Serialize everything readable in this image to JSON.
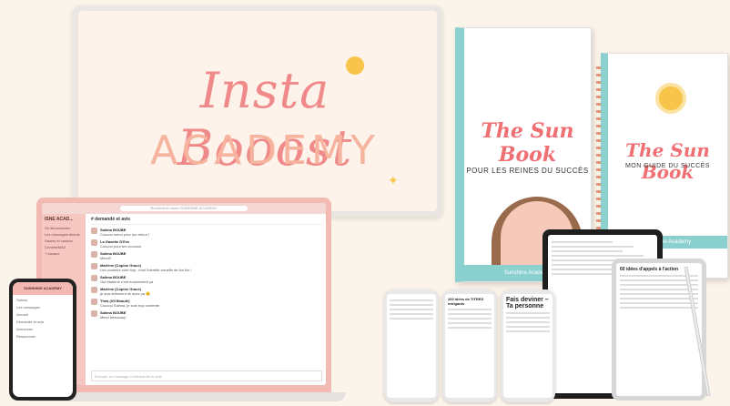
{
  "monitor": {
    "script_title": "Insta Booost",
    "block_title": "ACADEMY"
  },
  "laptop": {
    "search": "Rechercher dans SUNSHINE ACADEMY",
    "workspace": "ISNE ACAD...",
    "sidebar_items": [
      "Se déconnecter",
      "Les messages directs",
      "Salons et canaux",
      "Cercles/MAX",
      "+ canaux"
    ],
    "channel": "# demandé et avis",
    "messages": [
      {
        "name": "Salima BOUBE",
        "text": "Coucou merci pour ton retour !"
      },
      {
        "name": "La Gazette D'Eve",
        "text": "Coucou pour les coucous"
      },
      {
        "name": "Salima BOUBE",
        "text": "Merci!!"
      },
      {
        "name": "Marlène (Copine Grace)",
        "text": "Les couleurs sont trop, c'est l'identité visuelle de ton biz !"
      },
      {
        "name": "Salima BOUBE",
        "text": "Oui Marlène c'est exactement ça"
      },
      {
        "name": "Marlène (Copine Grace)",
        "text": "je suis tellement ok avec ça 😊"
      },
      {
        "name": "Théa (Vif Beauté)",
        "text": "Coucou Salima, je suis trop contente"
      },
      {
        "name": "Salima BOUBE",
        "text": "Merci beaucoup"
      }
    ],
    "composer": "Envoyer un message à #demandé et avis"
  },
  "phone_left": {
    "header": "SUNSHINE ACADEMY",
    "items": [
      "Salons",
      "Les messages",
      "Accueil",
      "Demandé et avis",
      "Annonces",
      "Ressources"
    ]
  },
  "book_left": {
    "title": "The Sun Book",
    "subtitle": "POUR LES REINES DU SUCCÈS",
    "banner": "Sunshine Academy"
  },
  "book_right": {
    "title": "The Sun Book",
    "subtitle": "MON GUIDE DU SUCCÈS",
    "banner": "Sunshine Academy"
  },
  "tablet_right": {
    "title": "60 idées d'appels à l'action"
  },
  "phones": [
    {
      "title": ""
    },
    {
      "title": "200 idées de TITRES intrigants"
    },
    {
      "title": "Fais deviner – Ta personne"
    }
  ],
  "colors": {
    "pink": "#f08a8a",
    "peach": "#f6b49f",
    "teal": "#8ad0cf",
    "sun": "#f8c44a",
    "background": "#fbf4ea"
  }
}
